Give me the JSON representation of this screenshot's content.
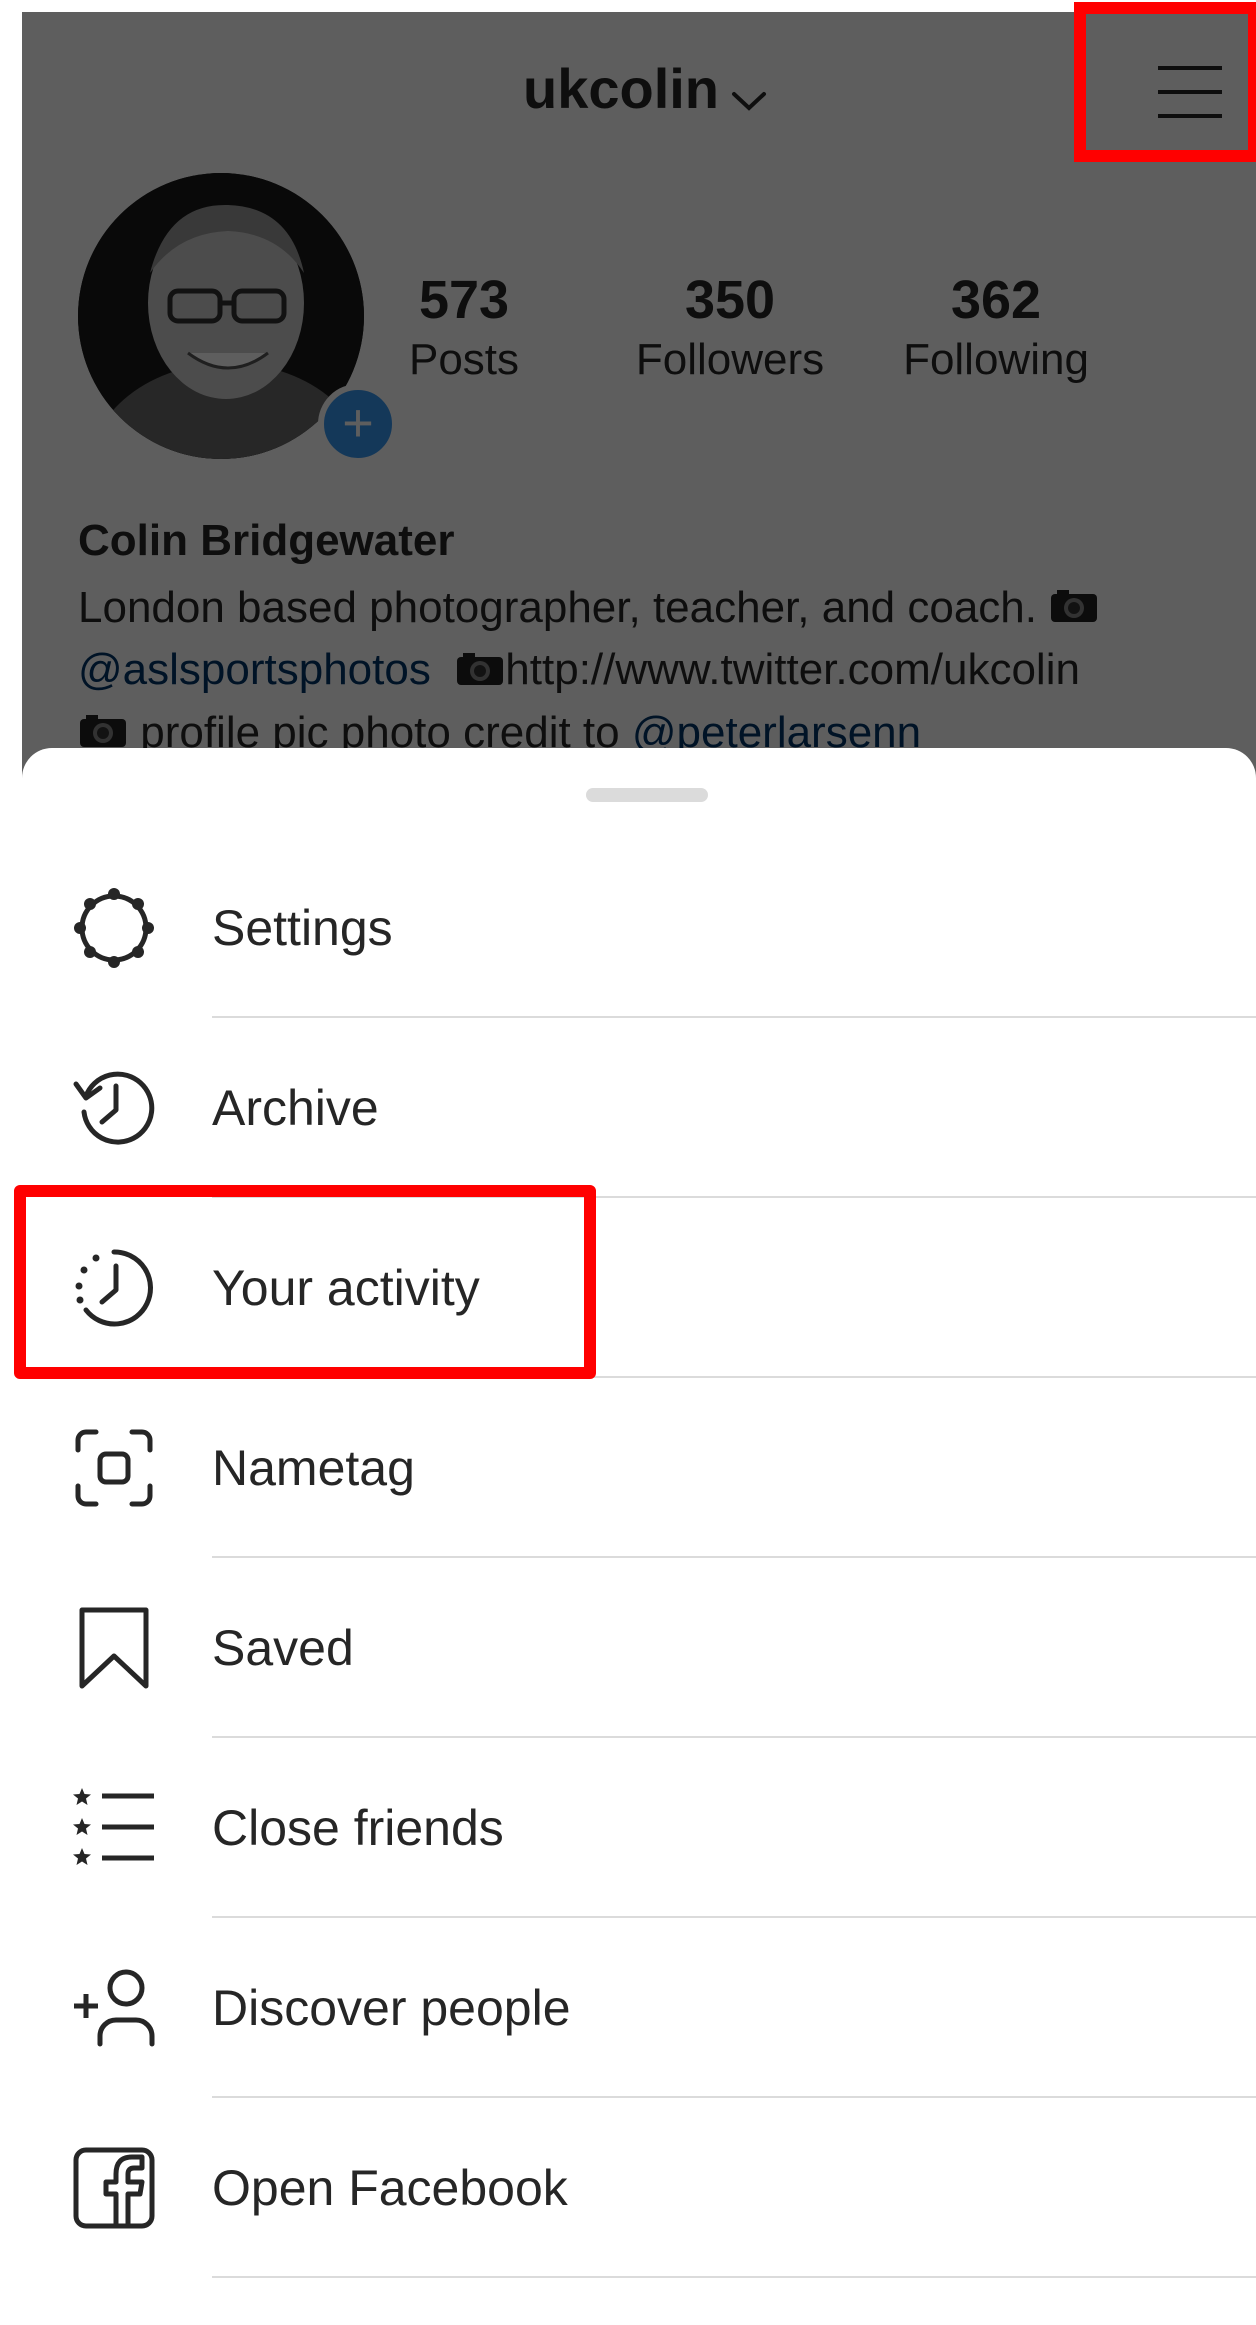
{
  "header": {
    "username": "ukcolin"
  },
  "profile": {
    "stats": [
      {
        "value": "573",
        "label": "Posts"
      },
      {
        "value": "350",
        "label": "Followers"
      },
      {
        "value": "362",
        "label": "Following"
      }
    ],
    "full_name": "Colin Bridgewater",
    "bio": {
      "line1": "London based photographer, teacher, and coach.",
      "mention1": "@aslsportsphotos",
      "link": "http://www.twitter.com/ukcolin",
      "line3": "profile pic photo credit to",
      "mention2": "@peterlarsenn"
    }
  },
  "menu": {
    "items": [
      {
        "label": "Settings",
        "icon": "settings-gear-icon"
      },
      {
        "label": "Archive",
        "icon": "archive-history-icon"
      },
      {
        "label": "Your activity",
        "icon": "activity-clock-icon"
      },
      {
        "label": "Nametag",
        "icon": "nametag-scan-icon"
      },
      {
        "label": "Saved",
        "icon": "bookmark-icon"
      },
      {
        "label": "Close friends",
        "icon": "star-list-icon"
      },
      {
        "label": "Discover people",
        "icon": "add-person-icon"
      },
      {
        "label": "Open Facebook",
        "icon": "facebook-icon"
      }
    ]
  },
  "colors": {
    "callout": "#ff0000",
    "link": "#003569",
    "accent": "#3897f0"
  }
}
